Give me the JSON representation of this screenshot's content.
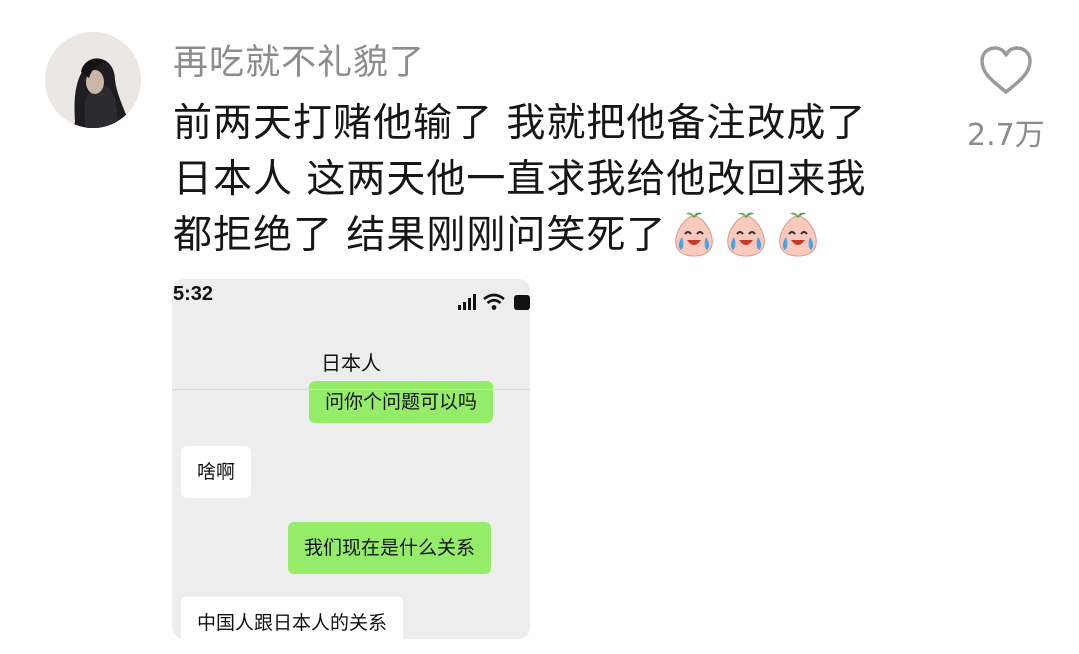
{
  "comment": {
    "username": "再吃就不礼貌了",
    "lines": [
      "前两天打赌他输了 我就把他备注改成了",
      "日本人 这两天他一直求我给他改回来我",
      "都拒绝了 结果刚刚问笑死了"
    ],
    "emojis": [
      "crying-laughing-peach-emoji",
      "crying-laughing-peach-emoji",
      "crying-laughing-peach-emoji"
    ],
    "like_count": "2.7万"
  },
  "screenshot": {
    "time": "5:32",
    "chat_title": "日本人",
    "messages": [
      {
        "side": "right",
        "text": "问你个问题可以吗"
      },
      {
        "side": "left",
        "text": "啥啊"
      },
      {
        "side": "right",
        "text": "我们现在是什么关系"
      },
      {
        "side": "left",
        "text": "中国人跟日本人的关系"
      }
    ]
  },
  "colors": {
    "bubble_sent": "#95ec69",
    "bubble_received": "#ffffff",
    "chat_background": "#ededed",
    "secondary_text": "#8c8c8c"
  }
}
